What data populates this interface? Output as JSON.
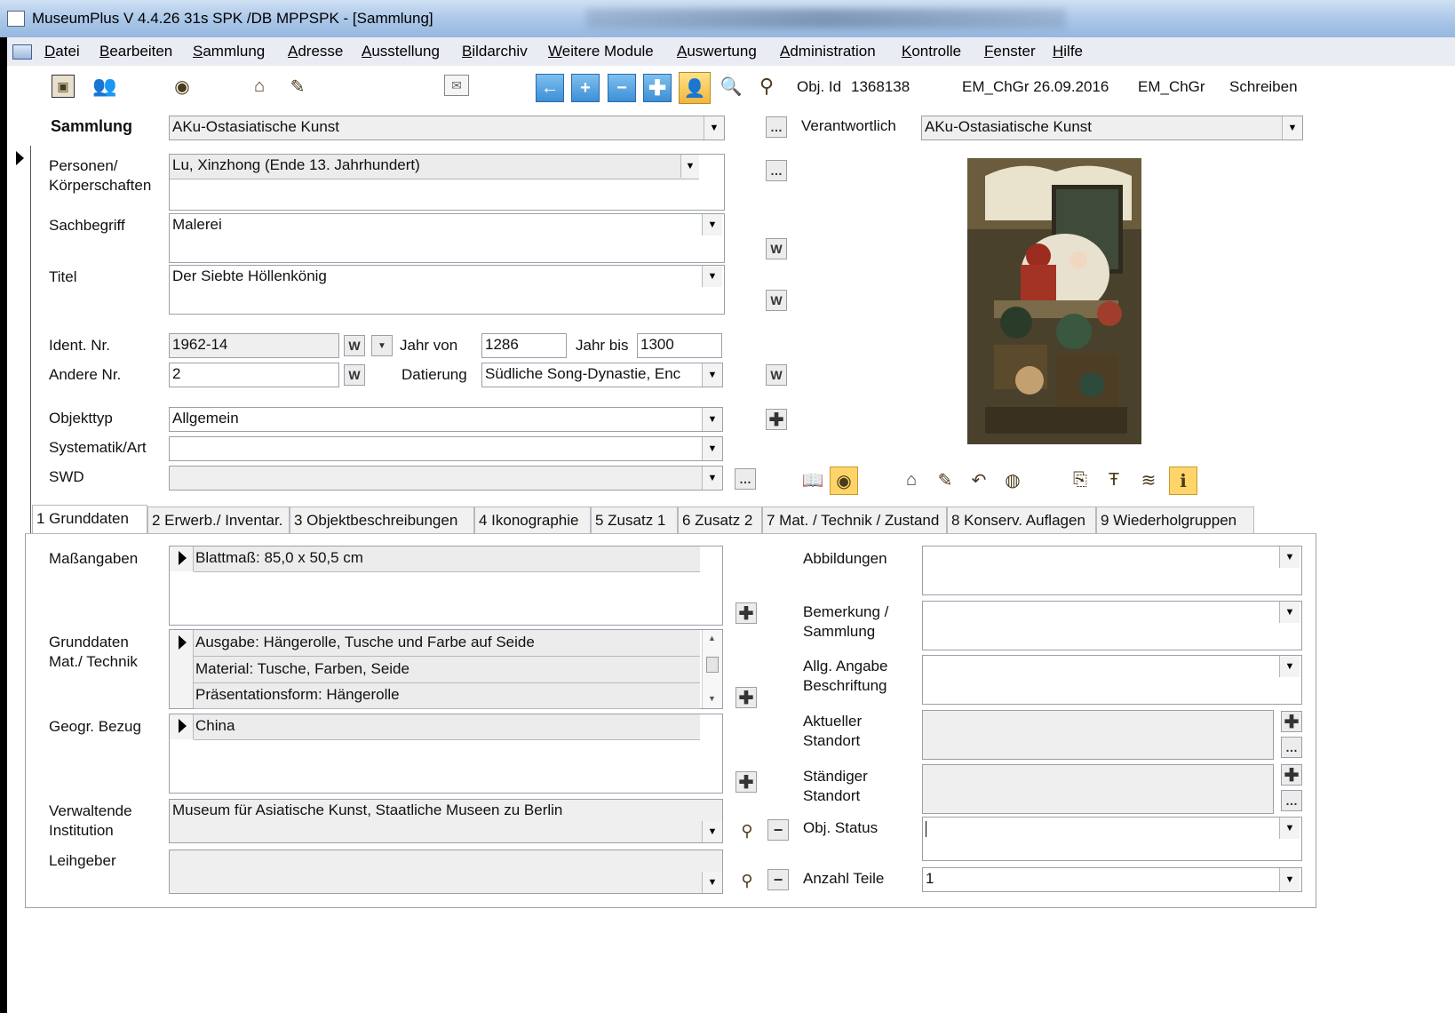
{
  "window": {
    "title": "MuseumPlus V 4.4.26 31s SPK /DB MPPSPK - [Sammlung]"
  },
  "menu": [
    "Datei",
    "Bearbeiten",
    "Sammlung",
    "Adresse",
    "Ausstellung",
    "Bildarchiv",
    "Weitere Module",
    "Auswertung",
    "Administration",
    "Kontrolle",
    "Fenster",
    "Hilfe"
  ],
  "toolbar": {
    "obj_id_label": "Obj. Id",
    "obj_id_value": "1368138",
    "editor_date": "EM_ChGr 26.09.2016",
    "editor": "EM_ChGr",
    "mode": "Schreiben",
    "icons": [
      "record-icon",
      "users-icon",
      "eye-icon",
      "home-icon",
      "pen-icon",
      "mail-icon",
      "back-arrow-icon",
      "add-icon",
      "remove-icon",
      "add-large-icon",
      "portrait-icon",
      "preview-icon",
      "binoculars-icon"
    ]
  },
  "form": {
    "sammlung_label": "Sammlung",
    "sammlung_value": "AKu-Ostasiatische Kunst",
    "verantwortlich_label": "Verantwortlich",
    "verantwortlich_value": "AKu-Ostasiatische Kunst",
    "personen_label": "Personen/\nKörperschaften",
    "personen_value": "Lu, Xinzhong (Ende 13. Jahrhundert)",
    "sachbegriff_label": "Sachbegriff",
    "sachbegriff_value": "Malerei",
    "titel_label": "Titel",
    "titel_value": "Der Siebte Höllenkönig",
    "ident_label": "Ident. Nr.",
    "ident_value": "1962-14",
    "jahr_von_label": "Jahr von",
    "jahr_von_value": "1286",
    "jahr_bis_label": "Jahr bis",
    "jahr_bis_value": "1300",
    "andere_label": "Andere Nr.",
    "andere_value": "2",
    "datierung_label": "Datierung",
    "datierung_value": "Südliche Song-Dynastie, Enc",
    "objekttyp_label": "Objekttyp",
    "objekttyp_value": "Allgemein",
    "systematik_label": "Systematik/Art",
    "systematik_value": "",
    "swd_label": "SWD",
    "swd_value": ""
  },
  "tabs": [
    "1 Grunddaten",
    "2 Erwerb./ Inventar.",
    "3 Objektbeschreibungen",
    "4 Ikonographie",
    "5 Zusatz 1",
    "6 Zusatz 2",
    "7 Mat. / Technik / Zustand",
    "8 Konserv. Auflagen",
    "9 Wiederholgruppen"
  ],
  "grunddaten": {
    "masse_label": "Maßangaben",
    "masse_rows": [
      "Blattmaß: 85,0 x 50,5 cm"
    ],
    "mat_label": "Grunddaten\nMat./ Technik",
    "mat_rows": [
      "Ausgabe: Hängerolle, Tusche und Farbe auf Seide",
      "Material: Tusche, Farben, Seide",
      "Präsentationsform: Hängerolle"
    ],
    "geo_label": "Geogr. Bezug",
    "geo_rows": [
      "China"
    ],
    "verw_label": "Verwaltende\nInstitution",
    "verw_value": "Museum für Asiatische Kunst, Staatliche Museen zu Berlin",
    "leihgeber_label": "Leihgeber",
    "leihgeber_value": "",
    "abbildungen_label": "Abbildungen",
    "bemerkung_label": "Bemerkung /\nSammlung",
    "allg_label": "Allg. Angabe\nBeschriftung",
    "aktueller_label": "Aktueller\nStandort",
    "staendiger_label": "Ständiger\nStandort",
    "status_label": "Obj. Status",
    "anzahl_label": "Anzahl Teile",
    "anzahl_value": "1"
  },
  "colors": {
    "accent_blue": "#3c8fd6",
    "window_bg": "#ffffff",
    "menubar_bg": "#e9ecf3"
  }
}
